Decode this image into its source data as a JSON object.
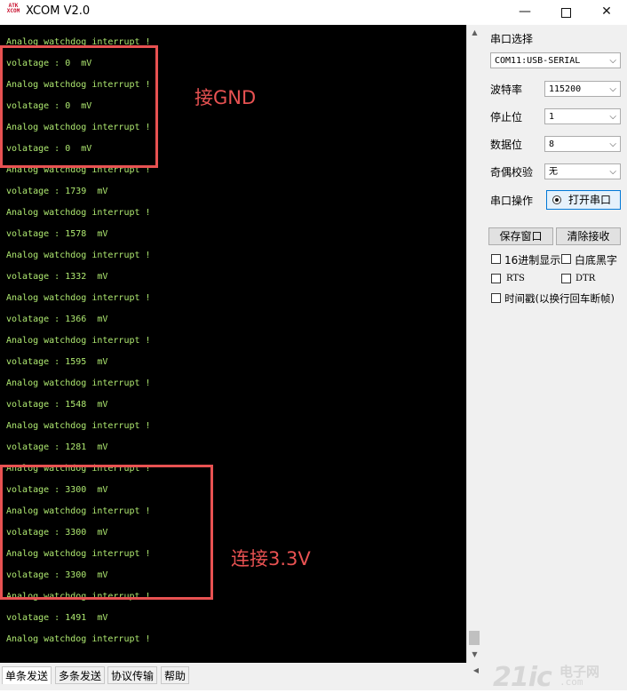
{
  "window": {
    "title": "XCOM V2.0",
    "icon_text": [
      "ATK",
      "XCOM"
    ],
    "minimize": "—",
    "close": "✕"
  },
  "terminal": {
    "lines": [
      "Analog watchdog interrupt !",
      "volatage : 0  mV",
      "Analog watchdog interrupt !",
      "volatage : 0  mV",
      "Analog watchdog interrupt !",
      "volatage : 0  mV",
      "Analog watchdog interrupt !",
      "volatage : 1739  mV",
      "Analog watchdog interrupt !",
      "volatage : 1578  mV",
      "Analog watchdog interrupt !",
      "volatage : 1332  mV",
      "Analog watchdog interrupt !",
      "volatage : 1366  mV",
      "Analog watchdog interrupt !",
      "volatage : 1595  mV",
      "Analog watchdog interrupt !",
      "volatage : 1548  mV",
      "Analog watchdog interrupt !",
      "volatage : 1281  mV",
      "Analog watchdog interrupt !",
      "volatage : 3300  mV",
      "Analog watchdog interrupt !",
      "volatage : 3300  mV",
      "Analog watchdog interrupt !",
      "volatage : 3300  mV",
      "Analog watchdog interrupt !",
      "volatage : 1491  mV",
      "Analog watchdog interrupt !"
    ],
    "text_color": "#aee870",
    "background": "#000000"
  },
  "annotations": {
    "gnd_label": "接GND",
    "v33_label": "连接3.3V",
    "color": "#e85252"
  },
  "panel": {
    "port_select_label": "串口选择",
    "port_value": "COM11:USB-SERIAL",
    "baud_label": "波特率",
    "baud_value": "115200",
    "stopbit_label": "停止位",
    "stopbit_value": "1",
    "databit_label": "数据位",
    "databit_value": "8",
    "parity_label": "奇偶校验",
    "parity_value": "无",
    "port_op_label": "串口操作",
    "open_port_button": "打开串口",
    "save_window_button": "保存窗口",
    "clear_receive_button": "清除接收",
    "hex_display_label": "16进制显示",
    "white_bg_label": "白底黑字",
    "rts_label": "RTS",
    "dtr_label": "DTR",
    "timestamp_label": "时间戳(以换行回车断帧)"
  },
  "tabs": [
    "单条发送",
    "多条发送",
    "协议传输",
    "帮助"
  ],
  "watermark": {
    "logo": "21ic",
    "cn": "电子网",
    "en": ".com"
  }
}
